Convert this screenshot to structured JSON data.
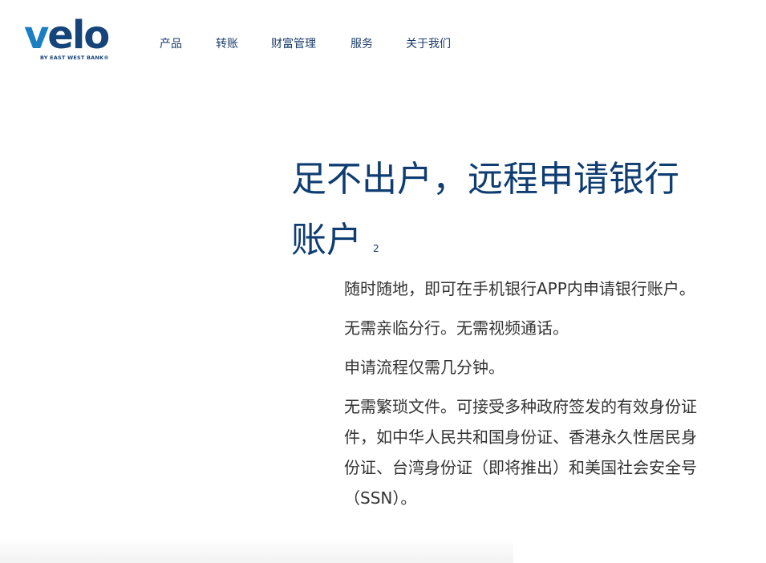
{
  "header": {
    "logo": {
      "wordmark_prefix": "v",
      "wordmark_rest": "elo",
      "tagline": "BY EAST WEST BANK®"
    },
    "nav": [
      {
        "label": "产品"
      },
      {
        "label": "转账"
      },
      {
        "label": "财富管理"
      },
      {
        "label": "服务"
      },
      {
        "label": "关于我们"
      }
    ]
  },
  "main": {
    "headline": "足不出户，远程申请银行账户",
    "footnote": "2",
    "paragraphs": [
      "随时随地，即可在手机银行APP内申请银行账户。",
      "无需亲临分行。无需视频通话。",
      "申请流程仅需几分钟。",
      "无需繁琐文件。可接受多种政府签发的有效身份证件，如中华人民共和国身份证、香港永久性居民身份证、台湾身份证（即将推出）和美国社会安全号（SSN）。"
    ]
  },
  "colors": {
    "brand_dark": "#14447a",
    "brand_accent": "#1b7fc4",
    "headline": "#0f3d72",
    "body_text": "#333333"
  }
}
